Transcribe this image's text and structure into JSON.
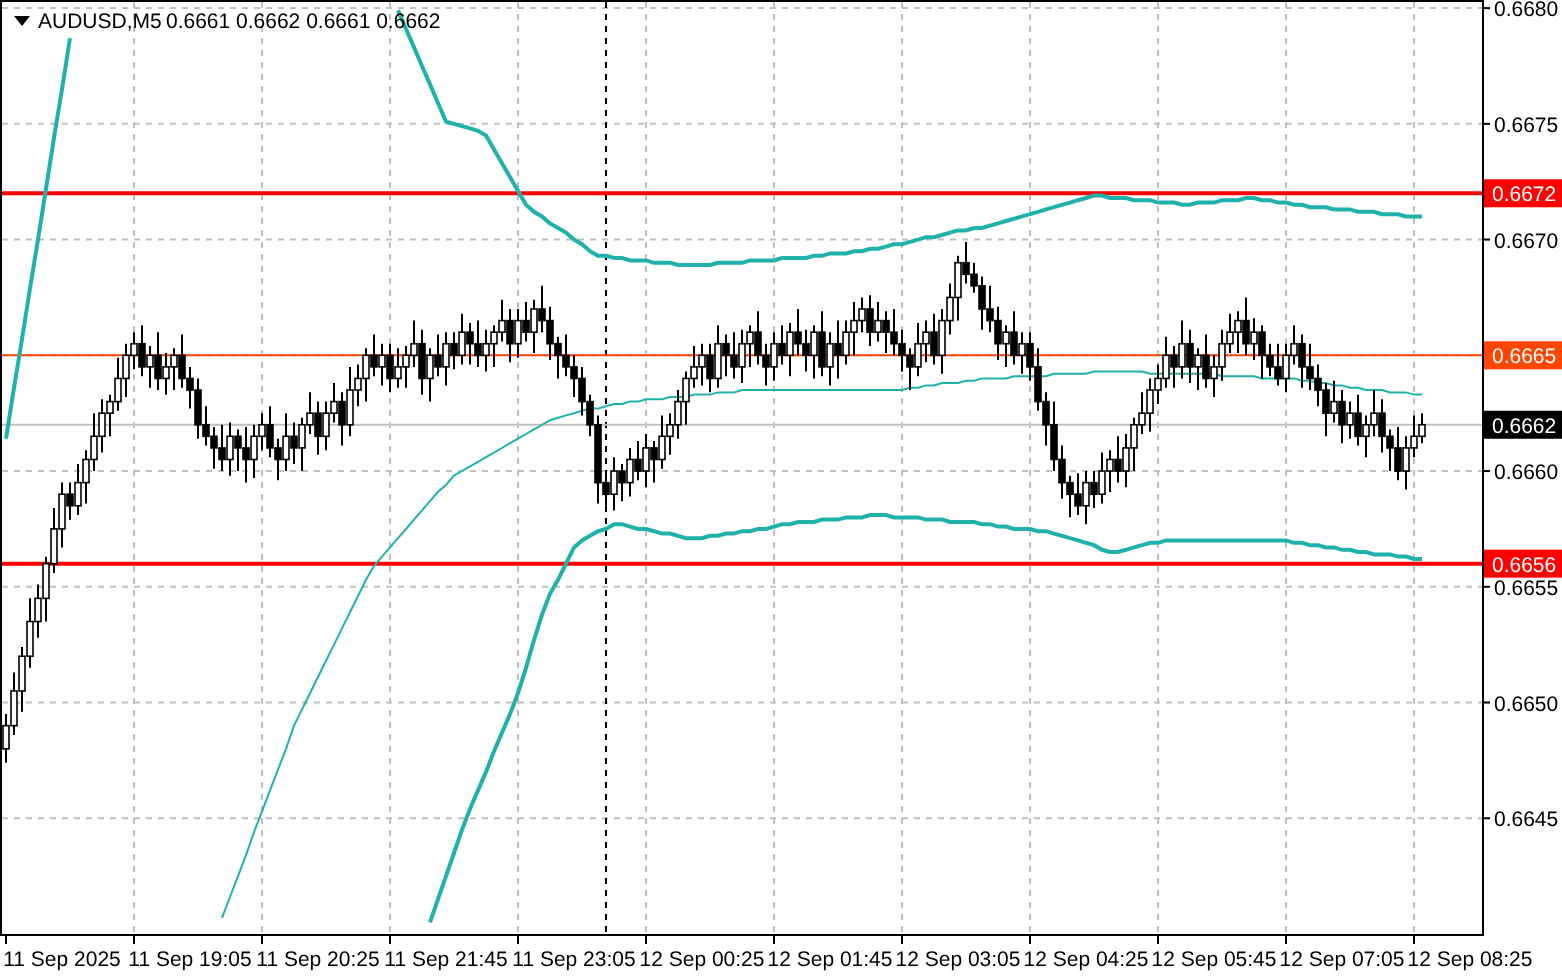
{
  "header": {
    "quotes": [
      "0.6661",
      "0.6662",
      "0.6661",
      "0.6662"
    ]
  },
  "price_chart": {
    "chart_data": {
      "type": "candlestick",
      "title": "AUDUSD,M5",
      "ylim": [
        0.664,
        0.668035
      ],
      "yticks": [
        {
          "value": 0.668,
          "label": "0.6680"
        },
        {
          "value": 0.6675,
          "label": "0.6675"
        },
        {
          "value": 0.667,
          "label": "0.6670"
        },
        {
          "value": 0.666,
          "label": "0.6660"
        },
        {
          "value": 0.6655,
          "label": "0.6655"
        },
        {
          "value": 0.665,
          "label": "0.6650"
        },
        {
          "value": 0.6645,
          "label": "0.6645"
        }
      ],
      "categories": [
        null,
        null,
        null,
        null,
        null,
        null,
        null,
        "11 Sep 2025",
        null,
        null,
        null,
        null,
        null,
        null,
        null,
        null,
        null,
        null,
        null,
        null,
        null,
        null,
        null,
        "11 Sep 19:05",
        null,
        null,
        null,
        null,
        null,
        null,
        null,
        null,
        null,
        null,
        null,
        null,
        null,
        null,
        null,
        "11 Sep 20:25",
        null,
        null,
        null,
        null,
        null,
        null,
        null,
        null,
        null,
        null,
        null,
        null,
        null,
        null,
        null,
        "11 Sep 21:45",
        null,
        null,
        null,
        null,
        null,
        null,
        null,
        null,
        null,
        null,
        null,
        null,
        null,
        null,
        null,
        "11 Sep 23:05",
        null,
        null,
        null,
        null,
        null,
        null,
        null,
        null,
        null,
        null,
        null,
        null,
        null,
        null,
        null,
        "12 Sep 00:25",
        null,
        null,
        null,
        null,
        null,
        null,
        null,
        null,
        null,
        null,
        null,
        null,
        null,
        null,
        null,
        "12 Sep 01:45",
        null,
        null,
        null,
        null,
        null,
        null,
        null,
        null,
        null,
        null,
        null,
        null,
        null,
        null,
        null,
        "12 Sep 03:05",
        null,
        null,
        null,
        null,
        null,
        null,
        null,
        null,
        null,
        null,
        null,
        null,
        null,
        null,
        null,
        "12 Sep 04:25",
        null,
        null,
        null,
        null,
        null,
        null,
        null,
        null,
        null,
        null,
        null,
        null,
        null,
        null,
        null,
        "12 Sep 05:45",
        null,
        null,
        null,
        null,
        null,
        null,
        null,
        null,
        null,
        null,
        null,
        null,
        null,
        null,
        null,
        "12 Sep 07:05",
        null,
        null,
        null,
        null,
        null,
        null,
        null,
        null,
        null,
        null,
        null,
        null,
        null,
        null,
        null,
        "12 Sep 08:25"
      ],
      "ohlc": [
        [
          0.6648,
          0.66495,
          0.66474,
          0.6649
        ],
        [
          0.6649,
          0.66513,
          0.66486,
          0.66505
        ],
        [
          0.66505,
          0.66524,
          0.66496,
          0.6652
        ],
        [
          0.6652,
          0.66545,
          0.66515,
          0.66535
        ],
        [
          0.66535,
          0.66551,
          0.66528,
          0.66545
        ],
        [
          0.66545,
          0.66563,
          0.66535,
          0.6656
        ],
        [
          0.6656,
          0.66584,
          0.66556,
          0.66575
        ],
        [
          0.66575,
          0.66595,
          0.66567,
          0.6659
        ],
        [
          0.6659,
          0.66595,
          0.66579,
          0.66585
        ],
        [
          0.66585,
          0.66603,
          0.66581,
          0.66595
        ],
        [
          0.66595,
          0.66609,
          0.66586,
          0.66605
        ],
        [
          0.66605,
          0.66625,
          0.666,
          0.66615
        ],
        [
          0.66615,
          0.66631,
          0.66608,
          0.66625
        ],
        [
          0.66625,
          0.66633,
          0.66615,
          0.6663
        ],
        [
          0.6663,
          0.66649,
          0.66626,
          0.6664
        ],
        [
          0.6664,
          0.66655,
          0.66632,
          0.6665
        ],
        [
          0.6665,
          0.6666,
          0.66644,
          0.66655
        ],
        [
          0.66655,
          0.66663,
          0.66641,
          0.66645
        ],
        [
          0.66645,
          0.66654,
          0.66636,
          0.6665
        ],
        [
          0.6665,
          0.6666,
          0.66635,
          0.6664
        ],
        [
          0.6664,
          0.66651,
          0.66633,
          0.66645
        ],
        [
          0.66645,
          0.66653,
          0.66635,
          0.6665
        ],
        [
          0.6665,
          0.66659,
          0.66636,
          0.6664
        ],
        [
          0.6664,
          0.66645,
          0.66627,
          0.66635
        ],
        [
          0.66635,
          0.6664,
          0.66614,
          0.6662
        ],
        [
          0.6662,
          0.66628,
          0.66611,
          0.66615
        ],
        [
          0.66615,
          0.66619,
          0.66601,
          0.6661
        ],
        [
          0.6661,
          0.6662,
          0.666,
          0.66605
        ],
        [
          0.66605,
          0.66621,
          0.66598,
          0.66615
        ],
        [
          0.66615,
          0.66618,
          0.666,
          0.6661
        ],
        [
          0.6661,
          0.66619,
          0.66595,
          0.66605
        ],
        [
          0.66605,
          0.6662,
          0.66597,
          0.66615
        ],
        [
          0.66615,
          0.66625,
          0.66609,
          0.6662
        ],
        [
          0.6662,
          0.66628,
          0.66606,
          0.6661
        ],
        [
          0.6661,
          0.66614,
          0.66596,
          0.66605
        ],
        [
          0.66605,
          0.66625,
          0.666,
          0.66615
        ],
        [
          0.66615,
          0.66621,
          0.66603,
          0.6661
        ],
        [
          0.6661,
          0.66623,
          0.666,
          0.6662
        ],
        [
          0.6662,
          0.66634,
          0.66616,
          0.66625
        ],
        [
          0.66625,
          0.6663,
          0.66607,
          0.66615
        ],
        [
          0.66615,
          0.6663,
          0.66609,
          0.66625
        ],
        [
          0.66625,
          0.66638,
          0.66621,
          0.6663
        ],
        [
          0.6663,
          0.66634,
          0.66611,
          0.6662
        ],
        [
          0.6662,
          0.66645,
          0.66615,
          0.66635
        ],
        [
          0.66635,
          0.66646,
          0.66628,
          0.6664
        ],
        [
          0.6664,
          0.66653,
          0.6663,
          0.6665
        ],
        [
          0.6665,
          0.66659,
          0.66641,
          0.66645
        ],
        [
          0.66645,
          0.66655,
          0.66637,
          0.6665
        ],
        [
          0.6665,
          0.66655,
          0.66634,
          0.6664
        ],
        [
          0.6664,
          0.66653,
          0.66636,
          0.66645
        ],
        [
          0.66645,
          0.66654,
          0.66636,
          0.6665
        ],
        [
          0.6665,
          0.66665,
          0.66645,
          0.66655
        ],
        [
          0.66655,
          0.66661,
          0.66633,
          0.6664
        ],
        [
          0.6664,
          0.66653,
          0.6663,
          0.6665
        ],
        [
          0.6665,
          0.66659,
          0.66641,
          0.66645
        ],
        [
          0.66645,
          0.6666,
          0.66637,
          0.66655
        ],
        [
          0.66655,
          0.6666,
          0.66644,
          0.6665
        ],
        [
          0.6665,
          0.66668,
          0.66646,
          0.6666
        ],
        [
          0.6666,
          0.66664,
          0.66646,
          0.66655
        ],
        [
          0.66655,
          0.66665,
          0.66645,
          0.6665
        ],
        [
          0.6665,
          0.66661,
          0.66643,
          0.66655
        ],
        [
          0.66655,
          0.66663,
          0.66645,
          0.6666
        ],
        [
          0.6666,
          0.66674,
          0.66656,
          0.66665
        ],
        [
          0.66665,
          0.6667,
          0.66647,
          0.66655
        ],
        [
          0.66655,
          0.6667,
          0.66649,
          0.66665
        ],
        [
          0.66665,
          0.66673,
          0.66656,
          0.6666
        ],
        [
          0.6666,
          0.66674,
          0.66651,
          0.6667
        ],
        [
          0.6667,
          0.6668,
          0.6666,
          0.66665
        ],
        [
          0.66665,
          0.66671,
          0.66648,
          0.66655
        ],
        [
          0.66655,
          0.66658,
          0.6664,
          0.6665
        ],
        [
          0.6665,
          0.66659,
          0.66641,
          0.66645
        ],
        [
          0.66645,
          0.6665,
          0.66632,
          0.6664
        ],
        [
          0.6664,
          0.66645,
          0.66624,
          0.6663
        ],
        [
          0.6663,
          0.66633,
          0.66615,
          0.6662
        ],
        [
          0.6662,
          0.66624,
          0.66586,
          0.66595
        ],
        [
          0.66595,
          0.666,
          0.66585,
          0.6659
        ],
        [
          0.6659,
          0.66606,
          0.66583,
          0.666
        ],
        [
          0.666,
          0.66603,
          0.66587,
          0.66595
        ],
        [
          0.66595,
          0.6661,
          0.66589,
          0.66605
        ],
        [
          0.66605,
          0.66613,
          0.66596,
          0.666
        ],
        [
          0.666,
          0.66616,
          0.66593,
          0.6661
        ],
        [
          0.6661,
          0.66613,
          0.66595,
          0.66605
        ],
        [
          0.66605,
          0.66624,
          0.66601,
          0.66615
        ],
        [
          0.66615,
          0.66625,
          0.66607,
          0.6662
        ],
        [
          0.6662,
          0.66635,
          0.66614,
          0.6663
        ],
        [
          0.6663,
          0.66643,
          0.6662,
          0.6664
        ],
        [
          0.6664,
          0.66654,
          0.66636,
          0.66645
        ],
        [
          0.66645,
          0.66655,
          0.66637,
          0.6665
        ],
        [
          0.6665,
          0.66655,
          0.66634,
          0.6664
        ],
        [
          0.6664,
          0.66663,
          0.66636,
          0.66655
        ],
        [
          0.66655,
          0.66659,
          0.66641,
          0.6665
        ],
        [
          0.6665,
          0.6666,
          0.6664,
          0.66645
        ],
        [
          0.66645,
          0.66661,
          0.66638,
          0.66655
        ],
        [
          0.66655,
          0.66663,
          0.66645,
          0.6666
        ],
        [
          0.6666,
          0.66669,
          0.66646,
          0.6665
        ],
        [
          0.6665,
          0.66655,
          0.66637,
          0.66645
        ],
        [
          0.66645,
          0.6666,
          0.66639,
          0.66655
        ],
        [
          0.66655,
          0.66663,
          0.66646,
          0.6665
        ],
        [
          0.6665,
          0.66664,
          0.66641,
          0.6666
        ],
        [
          0.6666,
          0.6667,
          0.6665,
          0.66655
        ],
        [
          0.66655,
          0.66661,
          0.66643,
          0.6665
        ],
        [
          0.6665,
          0.66663,
          0.6664,
          0.6666
        ],
        [
          0.6666,
          0.66669,
          0.66641,
          0.66645
        ],
        [
          0.66645,
          0.6666,
          0.66637,
          0.66655
        ],
        [
          0.66655,
          0.66665,
          0.6664,
          0.6665
        ],
        [
          0.6665,
          0.66665,
          0.66646,
          0.6666
        ],
        [
          0.6666,
          0.66673,
          0.6665,
          0.66665
        ],
        [
          0.66665,
          0.66675,
          0.6666,
          0.6667
        ],
        [
          0.6667,
          0.66676,
          0.66654,
          0.6666
        ],
        [
          0.6666,
          0.66673,
          0.66656,
          0.66665
        ],
        [
          0.66665,
          0.66669,
          0.66651,
          0.6666
        ],
        [
          0.6666,
          0.6667,
          0.6665,
          0.66655
        ],
        [
          0.66655,
          0.66661,
          0.66643,
          0.6665
        ],
        [
          0.6665,
          0.66653,
          0.66635,
          0.66645
        ],
        [
          0.66645,
          0.66664,
          0.66641,
          0.66655
        ],
        [
          0.66655,
          0.66665,
          0.66647,
          0.6666
        ],
        [
          0.6666,
          0.66668,
          0.66646,
          0.6665
        ],
        [
          0.6665,
          0.6667,
          0.66642,
          0.66665
        ],
        [
          0.66665,
          0.66681,
          0.66659,
          0.66675
        ],
        [
          0.66675,
          0.66693,
          0.66665,
          0.6669
        ],
        [
          0.6669,
          0.66699,
          0.66681,
          0.66685
        ],
        [
          0.66685,
          0.6669,
          0.66677,
          0.6668
        ],
        [
          0.6668,
          0.66684,
          0.66661,
          0.6667
        ],
        [
          0.6667,
          0.6668,
          0.6666,
          0.66665
        ],
        [
          0.66665,
          0.66671,
          0.66648,
          0.66655
        ],
        [
          0.66655,
          0.66663,
          0.66645,
          0.6666
        ],
        [
          0.6666,
          0.66669,
          0.66646,
          0.6665
        ],
        [
          0.6665,
          0.6666,
          0.66642,
          0.66655
        ],
        [
          0.66655,
          0.6666,
          0.66639,
          0.66645
        ],
        [
          0.66645,
          0.66653,
          0.66626,
          0.6663
        ],
        [
          0.6663,
          0.66634,
          0.66611,
          0.6662
        ],
        [
          0.6662,
          0.6663,
          0.666,
          0.66605
        ],
        [
          0.66605,
          0.66611,
          0.66588,
          0.66595
        ],
        [
          0.66595,
          0.66598,
          0.6658,
          0.6659
        ],
        [
          0.6659,
          0.66599,
          0.66581,
          0.66585
        ],
        [
          0.66585,
          0.666,
          0.66577,
          0.66595
        ],
        [
          0.66595,
          0.666,
          0.66584,
          0.6659
        ],
        [
          0.6659,
          0.66608,
          0.66586,
          0.666
        ],
        [
          0.666,
          0.66609,
          0.66591,
          0.66605
        ],
        [
          0.66605,
          0.66615,
          0.66595,
          0.666
        ],
        [
          0.666,
          0.66616,
          0.66593,
          0.6661
        ],
        [
          0.6661,
          0.66623,
          0.666,
          0.6662
        ],
        [
          0.6662,
          0.66634,
          0.66616,
          0.66625
        ],
        [
          0.66625,
          0.6664,
          0.66617,
          0.66635
        ],
        [
          0.66635,
          0.66646,
          0.66629,
          0.6664
        ],
        [
          0.6664,
          0.66658,
          0.66636,
          0.6665
        ],
        [
          0.6665,
          0.66654,
          0.66636,
          0.66645
        ],
        [
          0.66645,
          0.66665,
          0.6664,
          0.66655
        ],
        [
          0.66655,
          0.66661,
          0.66638,
          0.66645
        ],
        [
          0.66645,
          0.66653,
          0.66635,
          0.6665
        ],
        [
          0.6665,
          0.66659,
          0.66636,
          0.6664
        ],
        [
          0.6664,
          0.6665,
          0.66632,
          0.66645
        ],
        [
          0.66645,
          0.66661,
          0.66639,
          0.66655
        ],
        [
          0.66655,
          0.66668,
          0.66651,
          0.6666
        ],
        [
          0.6666,
          0.66669,
          0.66651,
          0.66665
        ],
        [
          0.66665,
          0.66675,
          0.6665,
          0.66655
        ],
        [
          0.66655,
          0.66666,
          0.66648,
          0.6666
        ],
        [
          0.6666,
          0.66663,
          0.6664,
          0.6665
        ],
        [
          0.6665,
          0.66655,
          0.66641,
          0.66645
        ],
        [
          0.66645,
          0.66655,
          0.66637,
          0.6664
        ],
        [
          0.6664,
          0.66655,
          0.66634,
          0.6665
        ],
        [
          0.6665,
          0.66663,
          0.66646,
          0.66655
        ],
        [
          0.66655,
          0.66659,
          0.66636,
          0.66645
        ],
        [
          0.66645,
          0.66655,
          0.66635,
          0.6664
        ],
        [
          0.6664,
          0.66646,
          0.66628,
          0.66635
        ],
        [
          0.66635,
          0.66638,
          0.66615,
          0.66625
        ],
        [
          0.66625,
          0.66639,
          0.66621,
          0.6663
        ],
        [
          0.6663,
          0.66635,
          0.66612,
          0.6662
        ],
        [
          0.6662,
          0.6663,
          0.66614,
          0.66625
        ],
        [
          0.66625,
          0.66633,
          0.66611,
          0.66615
        ],
        [
          0.66615,
          0.66624,
          0.66606,
          0.6662
        ],
        [
          0.6662,
          0.66635,
          0.66615,
          0.66625
        ],
        [
          0.66625,
          0.66631,
          0.66608,
          0.66615
        ],
        [
          0.66615,
          0.66618,
          0.666,
          0.6661
        ],
        [
          0.6661,
          0.66619,
          0.66596,
          0.666
        ],
        [
          0.666,
          0.66615,
          0.66592,
          0.6661
        ],
        [
          0.6661,
          0.66624,
          0.66606,
          0.66615
        ],
        [
          0.66615,
          0.66625,
          0.66612,
          0.6662
        ],
        null,
        null,
        null,
        null,
        null,
        null
      ]
    }
  },
  "bollinger_bands": {
    "chart_data": {
      "type": "line",
      "ylim": [
        0.664,
        0.668035
      ],
      "categories": [
        null,
        null,
        null,
        null,
        null,
        null,
        null,
        null,
        null,
        null,
        null,
        null,
        null,
        null,
        null,
        null,
        null,
        null,
        null,
        null,
        null,
        null,
        null,
        null,
        null,
        null,
        null,
        null,
        null,
        null,
        null,
        null,
        null,
        null,
        null,
        null,
        null,
        null,
        null,
        null,
        null,
        null,
        null,
        null,
        null,
        null,
        null,
        null,
        null,
        null,
        null,
        null,
        null,
        null,
        null,
        null,
        null,
        null,
        null,
        null,
        null,
        null,
        null,
        null,
        null,
        null,
        null,
        null,
        null,
        null,
        null,
        null,
        null,
        null,
        null,
        null,
        null,
        null,
        null,
        null,
        null,
        null,
        null,
        null,
        null,
        null,
        null,
        null,
        null,
        null,
        null,
        null,
        null,
        null,
        null,
        null,
        null,
        null,
        null,
        null,
        null,
        null,
        null,
        null,
        null,
        null,
        null,
        null,
        null,
        null,
        null,
        null,
        null,
        null,
        null,
        null,
        null,
        null,
        null,
        null,
        null,
        null,
        null,
        null,
        null,
        null,
        null,
        null,
        null,
        null,
        null,
        null,
        null,
        null,
        null,
        null,
        null,
        null,
        null,
        null,
        null,
        null,
        null,
        null,
        null,
        null,
        null,
        null,
        null,
        null,
        null,
        null,
        null,
        null,
        null,
        null,
        null,
        null,
        null,
        null,
        null,
        null,
        null,
        null,
        null,
        null,
        null,
        null,
        null,
        null,
        null,
        null,
        null,
        null,
        null,
        null,
        null,
        null,
        null,
        null,
        null,
        null,
        null,
        null
      ],
      "series": [
        {
          "color": "#20b2aa",
          "values": [
            0.66614,
            0.66636,
            0.66657,
            0.66679,
            0.667,
            0.66722,
            0.66744,
            0.66765,
            0.66787,
            null,
            null,
            null,
            null,
            null,
            null,
            null,
            null,
            null,
            null,
            null,
            null,
            null,
            null,
            null,
            null,
            null,
            null,
            null,
            null,
            null,
            null,
            null,
            null,
            null,
            null,
            null,
            null,
            null,
            null,
            null,
            null,
            null,
            null,
            null,
            null,
            null,
            null,
            null,
            null,
            0.66799,
            0.66791,
            0.66783,
            0.66775,
            0.66767,
            0.66759,
            0.66751,
            0.6675,
            0.66749,
            0.66748,
            0.66747,
            0.66745,
            0.66739,
            0.66733,
            0.66727,
            0.66721,
            0.66715,
            0.66712,
            0.6671,
            0.66707,
            0.66705,
            0.66703,
            0.667,
            0.66698,
            0.66695,
            0.66693,
            0.66693,
            0.66692,
            0.66692,
            0.66691,
            0.66691,
            0.66691,
            0.6669,
            0.6669,
            0.6669,
            0.66689,
            0.66689,
            0.66689,
            0.66689,
            0.66689,
            0.6669,
            0.6669,
            0.6669,
            0.6669,
            0.66691,
            0.66691,
            0.66691,
            0.66691,
            0.66692,
            0.66692,
            0.66692,
            0.66692,
            0.66693,
            0.66693,
            0.66694,
            0.66694,
            0.66694,
            0.66695,
            0.66695,
            0.66696,
            0.66696,
            0.66697,
            0.66698,
            0.66698,
            0.66699,
            0.667,
            0.66701,
            0.66701,
            0.66702,
            0.66703,
            0.66704,
            0.66704,
            0.66705,
            0.66705,
            0.66706,
            0.66707,
            0.66708,
            0.66709,
            0.6671,
            0.66711,
            0.66712,
            0.66713,
            0.66714,
            0.66715,
            0.66716,
            0.66717,
            0.66718,
            0.66719,
            0.66719,
            0.66718,
            0.66718,
            0.66718,
            0.66717,
            0.66717,
            0.66717,
            0.66716,
            0.66716,
            0.66716,
            0.66715,
            0.66715,
            0.66716,
            0.66716,
            0.66716,
            0.66717,
            0.66717,
            0.66717,
            0.66718,
            0.66718,
            0.66717,
            0.66717,
            0.66716,
            0.66716,
            0.66715,
            0.66715,
            0.66714,
            0.66714,
            0.66714,
            0.66713,
            0.66713,
            0.66713,
            0.66712,
            0.66712,
            0.66712,
            0.66711,
            0.66711,
            0.66711,
            0.6671,
            0.6671,
            0.6671,
            null,
            null,
            null,
            null,
            null,
            null
          ]
        },
        {
          "color": "#20b2aa",
          "values": [
            null,
            null,
            null,
            null,
            null,
            null,
            null,
            null,
            null,
            null,
            null,
            null,
            null,
            null,
            null,
            null,
            null,
            null,
            null,
            null,
            null,
            null,
            null,
            null,
            null,
            null,
            null,
            0.66407,
            0.66416,
            0.66425,
            0.66434,
            0.66444,
            0.66453,
            0.66462,
            0.66471,
            0.6648,
            0.6649,
            0.66497,
            0.66504,
            0.66511,
            0.66518,
            0.66525,
            0.66532,
            0.66539,
            0.66546,
            0.66553,
            0.66559,
            0.66563,
            0.66567,
            0.66571,
            0.66575,
            0.66579,
            0.66583,
            0.66587,
            0.66591,
            0.66594,
            0.66598,
            0.666,
            0.66602,
            0.66604,
            0.66606,
            0.66608,
            0.6661,
            0.66612,
            0.66614,
            0.66616,
            0.66618,
            0.6662,
            0.66622,
            0.66623,
            0.66624,
            0.66625,
            0.66626,
            0.66627,
            0.66627,
            0.66628,
            0.66629,
            0.66629,
            0.6663,
            0.6663,
            0.66631,
            0.66631,
            0.66631,
            0.66632,
            0.66632,
            0.66632,
            0.66633,
            0.66633,
            0.66633,
            0.66634,
            0.66634,
            0.66634,
            0.66635,
            0.66635,
            0.66635,
            0.66635,
            0.66635,
            0.66635,
            0.66635,
            0.66635,
            0.66635,
            0.66635,
            0.66635,
            0.66635,
            0.66635,
            0.66635,
            0.66635,
            0.66635,
            0.66635,
            0.66635,
            0.66635,
            0.66635,
            0.66635,
            0.66636,
            0.66636,
            0.66637,
            0.66637,
            0.66638,
            0.66638,
            0.66638,
            0.66639,
            0.66639,
            0.6664,
            0.6664,
            0.6664,
            0.6664,
            0.66641,
            0.66641,
            0.66641,
            0.66641,
            0.66641,
            0.66642,
            0.66642,
            0.66642,
            0.66642,
            0.66642,
            0.66643,
            0.66643,
            0.66643,
            0.66643,
            0.66643,
            0.66643,
            0.66643,
            0.66642,
            0.66642,
            0.66642,
            0.66642,
            0.66642,
            0.66642,
            0.66642,
            0.66642,
            0.66642,
            0.66641,
            0.66641,
            0.66641,
            0.66641,
            0.66641,
            0.6664,
            0.6664,
            0.6664,
            0.6664,
            0.6664,
            0.66639,
            0.66639,
            0.66638,
            0.66638,
            0.66637,
            0.66637,
            0.66636,
            0.66636,
            0.66635,
            0.66635,
            0.66635,
            0.66634,
            0.66634,
            0.66634,
            0.66633,
            0.66633,
            null,
            null,
            null,
            null,
            null,
            null
          ]
        },
        {
          "color": "#20b2aa",
          "values": [
            null,
            null,
            null,
            null,
            null,
            null,
            null,
            null,
            null,
            null,
            null,
            null,
            null,
            null,
            null,
            null,
            null,
            null,
            null,
            null,
            null,
            null,
            null,
            null,
            null,
            null,
            null,
            null,
            null,
            null,
            null,
            null,
            null,
            null,
            null,
            null,
            null,
            null,
            null,
            null,
            null,
            null,
            null,
            null,
            null,
            null,
            null,
            null,
            null,
            null,
            null,
            null,
            null,
            0.66405,
            0.66415,
            0.66425,
            0.66435,
            0.66445,
            0.66454,
            0.66462,
            0.6647,
            0.66479,
            0.66487,
            0.66495,
            0.66504,
            0.66515,
            0.66527,
            0.66538,
            0.66547,
            0.66553,
            0.6656,
            0.66567,
            0.6657,
            0.66572,
            0.66574,
            0.66575,
            0.66577,
            0.66577,
            0.66576,
            0.66575,
            0.66575,
            0.66574,
            0.66573,
            0.66573,
            0.66572,
            0.66571,
            0.66571,
            0.66571,
            0.66572,
            0.66572,
            0.66573,
            0.66573,
            0.66574,
            0.66574,
            0.66575,
            0.66575,
            0.66576,
            0.66577,
            0.66577,
            0.66578,
            0.66578,
            0.66578,
            0.66579,
            0.66579,
            0.66579,
            0.6658,
            0.6658,
            0.6658,
            0.66581,
            0.66581,
            0.66581,
            0.6658,
            0.6658,
            0.6658,
            0.6658,
            0.66579,
            0.66579,
            0.66579,
            0.66578,
            0.66578,
            0.66578,
            0.66578,
            0.66577,
            0.66577,
            0.66576,
            0.66576,
            0.66575,
            0.66575,
            0.66575,
            0.66574,
            0.66574,
            0.66573,
            0.66572,
            0.66571,
            0.6657,
            0.66569,
            0.66568,
            0.66566,
            0.66565,
            0.66565,
            0.66566,
            0.66567,
            0.66568,
            0.66569,
            0.66569,
            0.6657,
            0.6657,
            0.6657,
            0.6657,
            0.6657,
            0.6657,
            0.6657,
            0.6657,
            0.6657,
            0.6657,
            0.6657,
            0.6657,
            0.6657,
            0.6657,
            0.6657,
            0.6657,
            0.66569,
            0.66569,
            0.66568,
            0.66568,
            0.66567,
            0.66567,
            0.66566,
            0.66566,
            0.66565,
            0.66565,
            0.66564,
            0.66564,
            0.66564,
            0.66563,
            0.66563,
            0.66562,
            0.66562,
            null,
            null,
            null,
            null,
            null,
            null
          ]
        }
      ]
    }
  },
  "price_levels": [
    {
      "kind": "line",
      "label": "0.6672",
      "color": "#ff0000"
    },
    {
      "kind": "line",
      "label": "0.6665",
      "color": "#ff4500"
    },
    {
      "kind": "bid",
      "label": "0.6662",
      "color": "#000000"
    },
    {
      "kind": "line",
      "label": "0.6656",
      "color": "#ff0000"
    }
  ]
}
